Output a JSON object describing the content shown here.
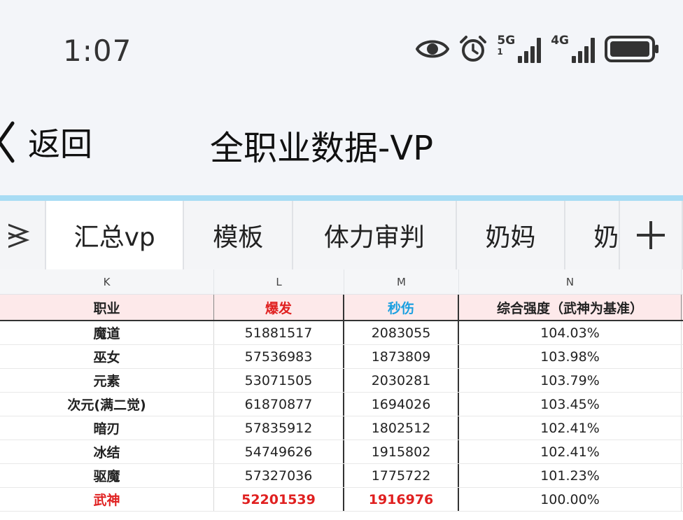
{
  "status": {
    "time": "1:07",
    "net1": "5G",
    "net1_sub": "1",
    "net2": "4G"
  },
  "nav": {
    "back_label": "返回",
    "title": "全职业数据-VP"
  },
  "tabs": [
    {
      "label": "汇总vp",
      "active": true
    },
    {
      "label": "模板",
      "active": false
    },
    {
      "label": "体力审判",
      "active": false
    },
    {
      "label": "奶妈",
      "active": false
    },
    {
      "label": "奶",
      "active": false
    }
  ],
  "columns": [
    "K",
    "L",
    "M",
    "N"
  ],
  "table": {
    "headers": [
      "职业",
      "爆发",
      "秒伤",
      "综合强度（武神为基准）"
    ],
    "rows": [
      [
        "魔道",
        "51881517",
        "2083055",
        "104.03%"
      ],
      [
        "巫女",
        "57536983",
        "1873809",
        "103.98%"
      ],
      [
        "元素",
        "53071505",
        "2030281",
        "103.79%"
      ],
      [
        "次元(满二觉)",
        "61870877",
        "1694026",
        "103.45%"
      ],
      [
        "暗刃",
        "57835912",
        "1802512",
        "102.41%"
      ],
      [
        "冰结",
        "54749626",
        "1915802",
        "102.41%"
      ],
      [
        "驱魔",
        "57327036",
        "1775722",
        "101.23%"
      ],
      [
        "武神",
        "52201539",
        "1916976",
        "100.00%"
      ]
    ]
  },
  "colors": {
    "accent": "#a8dcf4",
    "header_bg": "#fde9ea",
    "highlight_red": "#e02020",
    "highlight_blue": "#1a9fe0"
  }
}
